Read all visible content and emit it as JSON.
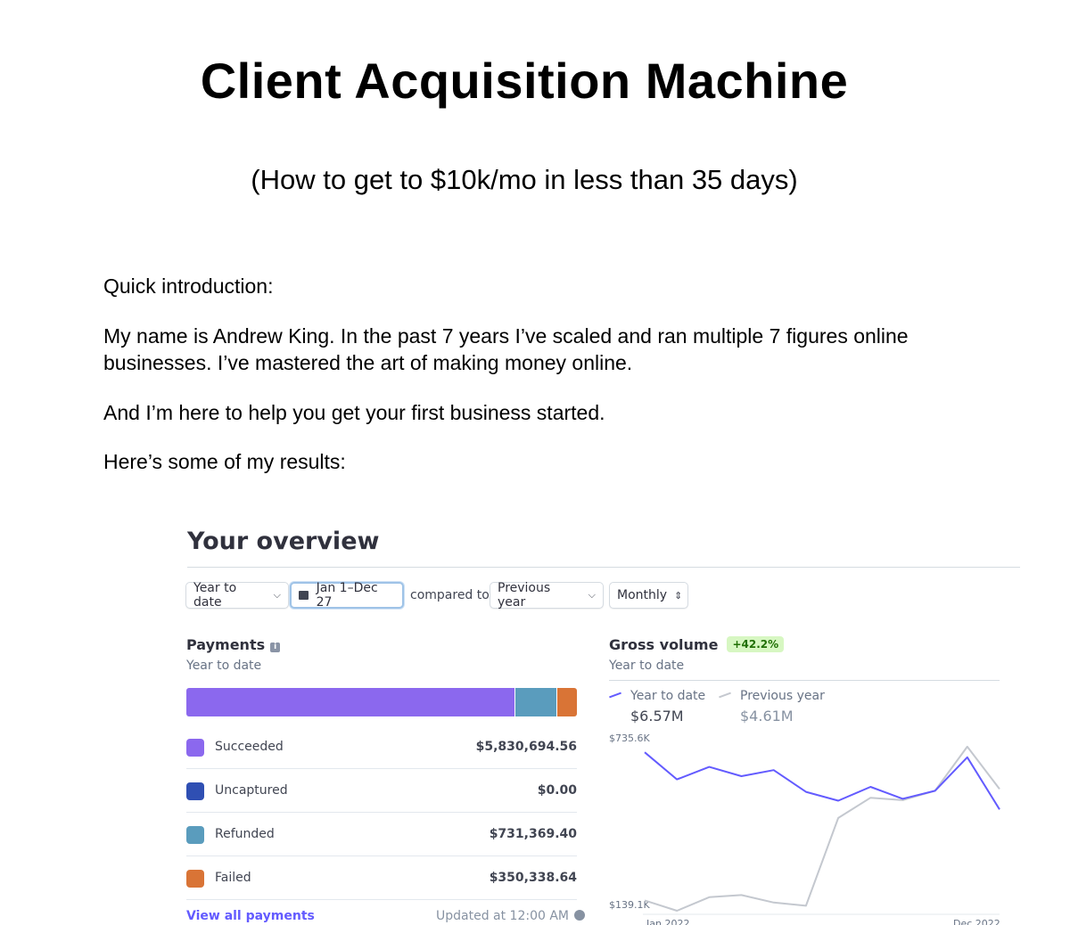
{
  "document": {
    "title": "Client Acquisition Machine",
    "subtitle": "(How to get to $10k/mo in less than 35 days)",
    "paragraphs": [
      "Quick introduction:",
      "My name is Andrew King. In the past 7 years I’ve scaled and ran multiple 7 figures online businesses. I’ve mastered the art of making money online.",
      "And I’m here to help you get your first business started.",
      "Here’s some of my results:"
    ]
  },
  "overview": {
    "title": "Your overview",
    "filters": {
      "range": "Year to date",
      "date": "Jan 1–Dec 27",
      "compared_to_label": "compared to",
      "comparison": "Previous year",
      "interval": "Monthly"
    }
  },
  "payments": {
    "title": "Payments",
    "subtitle": "Year to date",
    "rows": [
      {
        "label": "Succeeded",
        "value": "$5,830,694.56",
        "color": "#8b68ee"
      },
      {
        "label": "Uncaptured",
        "value": "$0.00",
        "color": "#2f4fb3"
      },
      {
        "label": "Refunded",
        "value": "$731,369.40",
        "color": "#5a9cbd"
      },
      {
        "label": "Failed",
        "value": "$350,338.64",
        "color": "#d97436"
      }
    ],
    "bar_shares": [
      0.843,
      0.0,
      0.106,
      0.051
    ],
    "view_all_label": "View all payments",
    "updated_label": "Updated at 12:00 AM"
  },
  "gross_volume": {
    "title": "Gross volume",
    "change_badge": "+42.2%",
    "subtitle": "Year to date",
    "legend": [
      {
        "name": "Year to date",
        "total": "$6.57M",
        "color": "#635bff"
      },
      {
        "name": "Previous year",
        "total": "$4.61M",
        "color": "#c4c8cf"
      }
    ]
  },
  "chart_data": {
    "type": "line",
    "x_labels": [
      "Jan 2022",
      "Dec 2022"
    ],
    "y_ticks": [
      "$735.6K",
      "$139.1K"
    ],
    "ylim": [
      139.1,
      735.6
    ],
    "series": [
      {
        "name": "Year to date",
        "values": [
          735,
          633,
          680,
          645,
          668,
          586,
          553,
          605,
          560,
          590,
          716,
          520
        ]
      },
      {
        "name": "Previous year",
        "values": [
          178,
          139,
          190,
          198,
          170,
          158,
          488,
          564,
          555,
          590,
          756,
          597
        ]
      }
    ]
  }
}
